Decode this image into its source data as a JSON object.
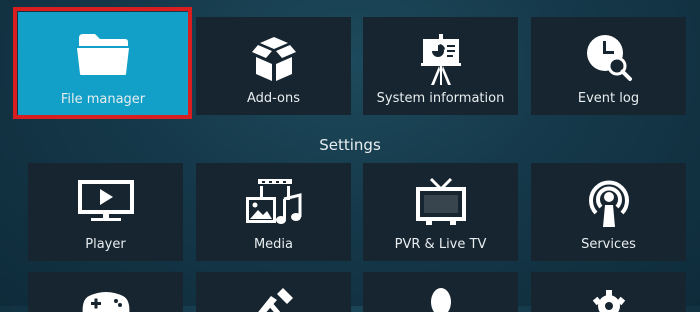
{
  "top_row": [
    {
      "label": "File manager",
      "icon": "folder-icon",
      "selected": true
    },
    {
      "label": "Add-ons",
      "icon": "open-box-icon"
    },
    {
      "label": "System information",
      "icon": "presentation-board-icon"
    },
    {
      "label": "Event log",
      "icon": "clock-search-icon"
    }
  ],
  "settings": {
    "title": "Settings",
    "items": [
      {
        "label": "Player",
        "icon": "monitor-play-icon"
      },
      {
        "label": "Media",
        "icon": "media-film-music-icon"
      },
      {
        "label": "PVR & Live TV",
        "icon": "tv-antenna-icon"
      },
      {
        "label": "Services",
        "icon": "broadcast-icon"
      }
    ]
  },
  "colors": {
    "selected_tile": "#12a0c8",
    "selection_frame": "#d81e1e",
    "tile": "#16252f"
  }
}
